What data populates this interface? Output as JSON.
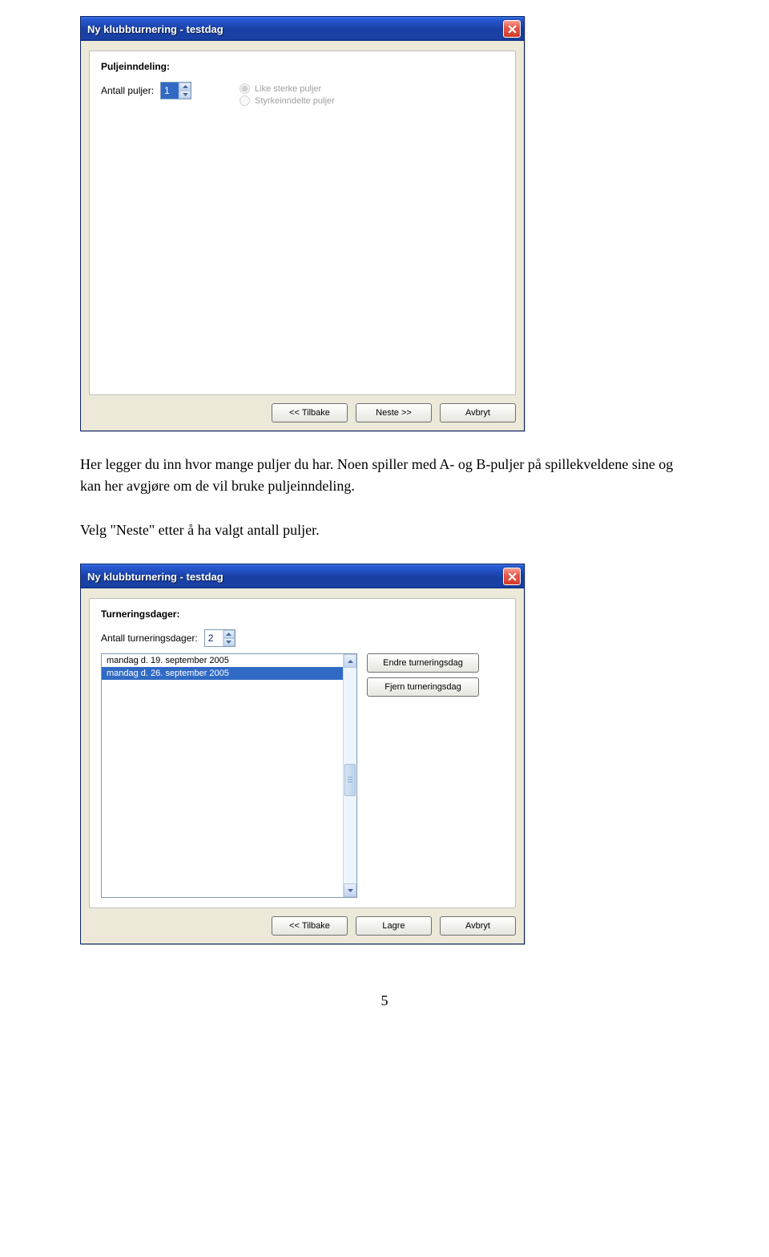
{
  "dialog1": {
    "title": "Ny klubbturnering - testdag",
    "section": "Puljeinndeling:",
    "field_label": "Antall puljer:",
    "field_value": "1",
    "radio1": "Like sterke puljer",
    "radio2": "Styrkeinndelte puljer",
    "buttons": {
      "back": "<< Tilbake",
      "next": "Neste >>",
      "cancel": "Avbryt"
    }
  },
  "para1": "Her legger du inn hvor mange puljer du har. Noen spiller med A- og B-puljer på spillekveldene sine og kan her avgjøre om de vil bruke puljeinndeling.",
  "para2": "Velg \"Neste\" etter å ha valgt antall puljer.",
  "dialog2": {
    "title": "Ny klubbturnering - testdag",
    "section": "Turneringsdager:",
    "field_label": "Antall turneringsdager:",
    "field_value": "2",
    "list": [
      "mandag d. 19. september 2005",
      "mandag d. 26. september 2005"
    ],
    "side_buttons": {
      "edit": "Endre turneringsdag",
      "remove": "Fjern turneringsdag"
    },
    "buttons": {
      "back": "<< Tilbake",
      "save": "Lagre",
      "cancel": "Avbryt"
    }
  },
  "page_number": "5"
}
